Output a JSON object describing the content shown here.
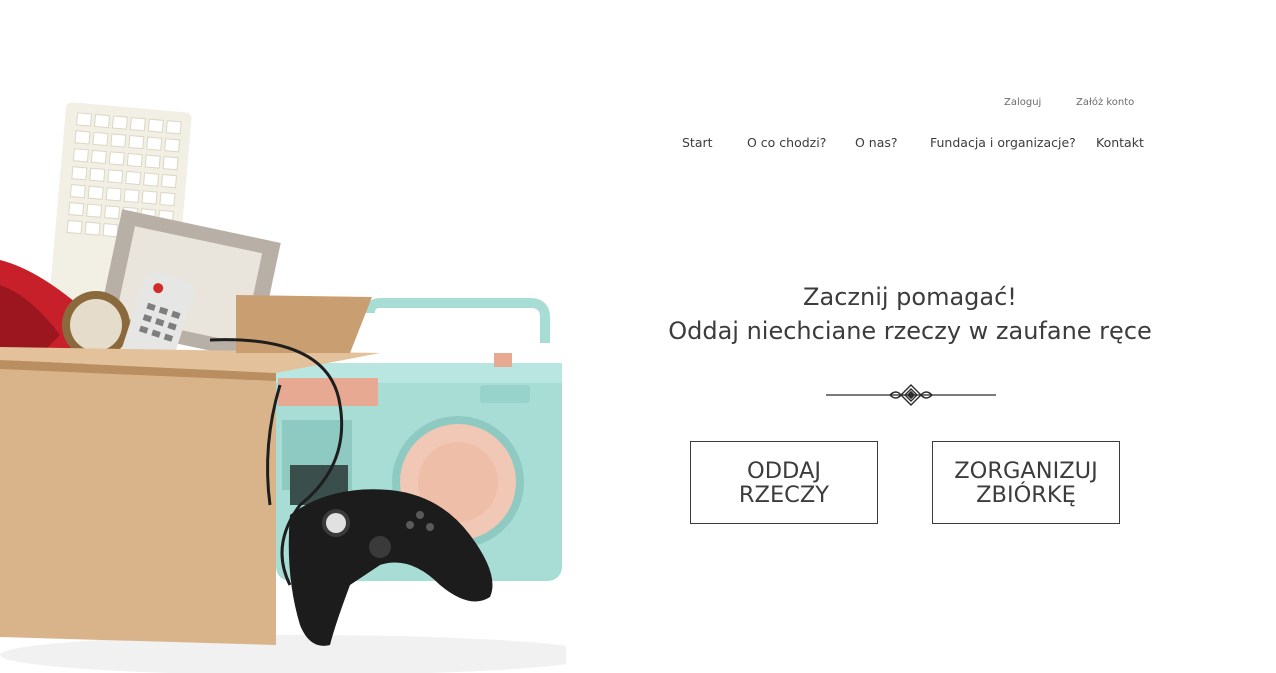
{
  "auth": {
    "login": "Zaloguj",
    "register": "Załóż konto"
  },
  "nav": {
    "start": "Start",
    "about": "O co chodzi?",
    "us": "O nas?",
    "foundations": "Fundacja i organizacje?",
    "contact": "Kontakt"
  },
  "hero": {
    "line1": "Zacznij pomagać!",
    "line2": "Oddaj niechciane rzeczy w zaufane ręce"
  },
  "cta": {
    "give_line1": "ODDAJ",
    "give_line2": "RZECZY",
    "organize_line1": "ZORGANIZUJ",
    "organize_line2": "ZBIÓRKĘ"
  },
  "colors": {
    "text": "#3c3c3c",
    "box": "#d9b48a",
    "radio": "#a8ddd6",
    "phone": "#c8202b"
  },
  "icons": {
    "ornament": "decoration-ornament-icon"
  }
}
